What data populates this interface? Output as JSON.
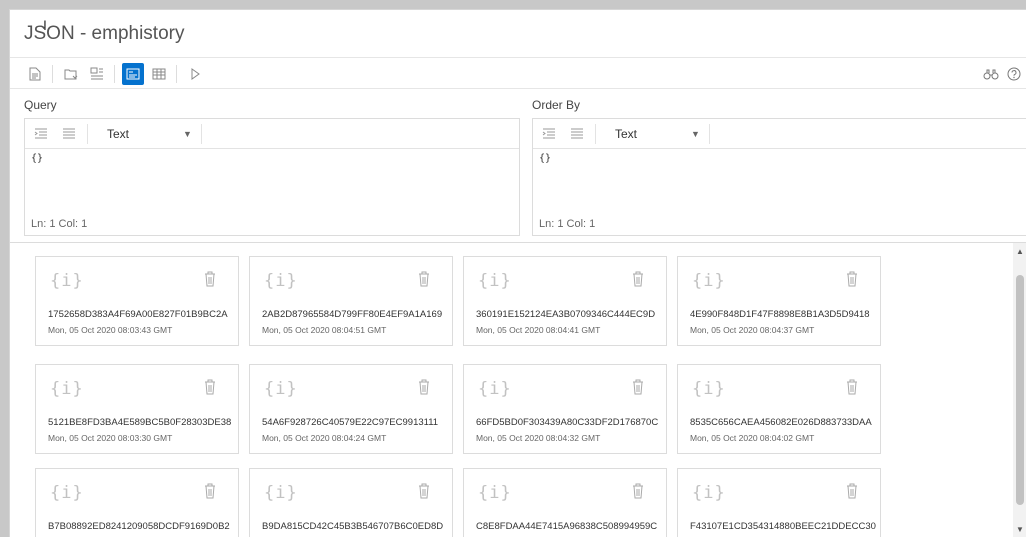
{
  "title": "JSON - emphistory",
  "toolbar": {
    "buttons": [
      {
        "name": "document-icon",
        "glyph": "🗎"
      },
      {
        "name": "open-folder-icon",
        "glyph": "⎙"
      },
      {
        "name": "qbe-icon",
        "glyph": "⊞"
      },
      {
        "name": "card-view-icon",
        "glyph": "▣"
      },
      {
        "name": "table-view-icon",
        "glyph": "▦"
      },
      {
        "name": "run-icon",
        "glyph": "▷"
      }
    ],
    "right": [
      {
        "name": "binoculars-icon",
        "glyph": "⌕"
      },
      {
        "name": "help-icon",
        "glyph": "?"
      }
    ]
  },
  "query": {
    "label": "Query",
    "format": "Text",
    "content": "{}",
    "status": "Ln: 1   Col: 1"
  },
  "order_by": {
    "label": "Order By",
    "format": "Text",
    "content": "{}",
    "status": "Ln: 1   Col: 1"
  },
  "cards": [
    {
      "icon": "{i}",
      "id": "1752658D383A4F69A00E827F01B9BC2A",
      "date": "Mon, 05 Oct 2020 08:03:43 GMT"
    },
    {
      "icon": "{i}",
      "id": "2AB2D87965584D799FF80E4EF9A1A169",
      "date": "Mon, 05 Oct 2020 08:04:51 GMT"
    },
    {
      "icon": "{i}",
      "id": "360191E152124EA3B0709346C444EC9D",
      "date": "Mon, 05 Oct 2020 08:04:41 GMT"
    },
    {
      "icon": "{i}",
      "id": "4E990F848D1F47F8898E8B1A3D5D9418",
      "date": "Mon, 05 Oct 2020 08:04:37 GMT"
    },
    {
      "icon": "{i}",
      "id": "5121BE8FD3BA4E589BC5B0F28303DE38",
      "date": "Mon, 05 Oct 2020 08:03:30 GMT"
    },
    {
      "icon": "{i}",
      "id": "54A6F928726C40579E22C97EC9913111",
      "date": "Mon, 05 Oct 2020 08:04:24 GMT"
    },
    {
      "icon": "{i}",
      "id": "66FD5BD0F303439A80C33DF2D176870C",
      "date": "Mon, 05 Oct 2020 08:04:32 GMT"
    },
    {
      "icon": "{i}",
      "id": "8535C656CAEA456082E026D883733DAA",
      "date": "Mon, 05 Oct 2020 08:04:02 GMT"
    },
    {
      "icon": "{i}",
      "id": "B7B08892ED8241209058DCDF9169D0B2",
      "date": ""
    },
    {
      "icon": "{i}",
      "id": "B9DA815CD42C45B3B546707B6C0ED8D",
      "date": ""
    },
    {
      "icon": "{i}",
      "id": "C8E8FDAA44E7415A96838C508994959C",
      "date": ""
    },
    {
      "icon": "{i}",
      "id": "F43107E1CD354314880BEEC21DDECC30",
      "date": ""
    }
  ],
  "colors": {
    "accent": "#0572ce",
    "card_border": "#dcdcdc",
    "icon_gray": "#c2c2c2"
  }
}
